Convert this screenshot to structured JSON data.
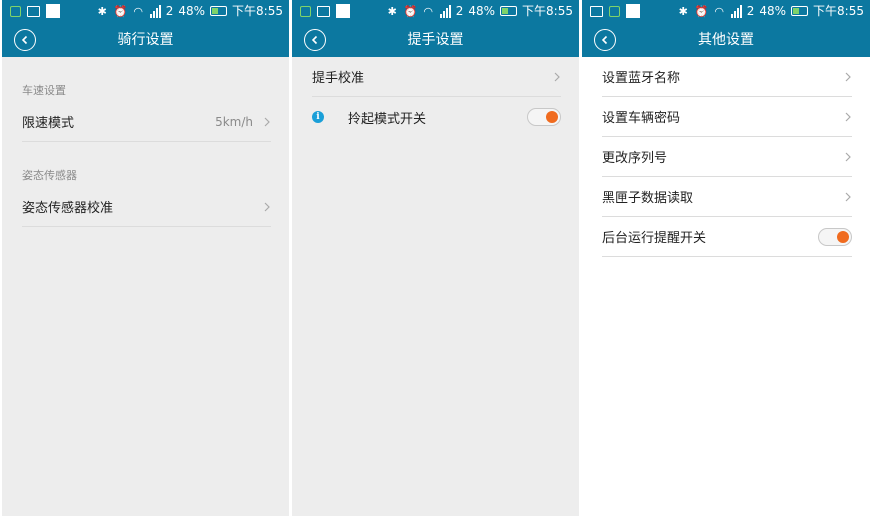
{
  "status_bar": {
    "battery_percent": "48%",
    "time": "下午8:55",
    "signal_badge": "2"
  },
  "screens": [
    {
      "title": "骑行设置",
      "sections": [
        {
          "label": "车速设置",
          "rows": [
            {
              "label": "限速模式",
              "value": "5km/h",
              "control": "chevron"
            }
          ]
        },
        {
          "label": "姿态传感器",
          "rows": [
            {
              "label": "姿态传感器校准",
              "control": "chevron"
            }
          ]
        }
      ]
    },
    {
      "title": "提手设置",
      "rows": [
        {
          "label": "提手校准",
          "control": "chevron"
        },
        {
          "label": "拎起模式开关",
          "control": "toggle",
          "state": "on",
          "has_info_icon": true
        }
      ]
    },
    {
      "title": "其他设置",
      "rows": [
        {
          "label": "设置蓝牙名称",
          "control": "chevron"
        },
        {
          "label": "设置车辆密码",
          "control": "chevron"
        },
        {
          "label": "更改序列号",
          "control": "chevron"
        },
        {
          "label": "黑匣子数据读取",
          "control": "chevron"
        },
        {
          "label": "后台运行提醒开关",
          "control": "toggle",
          "state": "on"
        }
      ]
    }
  ],
  "colors": {
    "header": "#0c78a0",
    "toggle_on": "#f06b1f",
    "info_icon": "#1a9fd8",
    "page_bg_gray": "#ededed",
    "page_bg_white": "#ffffff"
  },
  "icons": [
    "notification-icon",
    "image-icon",
    "bluetooth-icon",
    "alarm-icon",
    "wifi-icon",
    "signal-icon",
    "battery-icon",
    "back-icon",
    "chevron-right-icon",
    "info-icon"
  ]
}
